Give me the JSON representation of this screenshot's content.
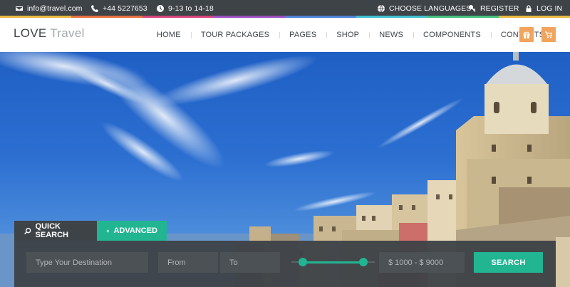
{
  "topbar": {
    "email": "info@travel.com",
    "phone": "+44 5227653",
    "hours": "9-13 to 14-18",
    "languages": "CHOOSE LANGUAGES",
    "register": "REGISTER",
    "login": "LOG IN"
  },
  "brand": {
    "bold": "LOVE",
    "light": "Travel"
  },
  "nav": {
    "items": [
      "HOME",
      "TOUR PACKAGES",
      "PAGES",
      "SHOP",
      "NEWS",
      "COMPONENTS",
      "CONTACTS"
    ]
  },
  "search": {
    "tabs": {
      "quick": "QUICK SEARCH",
      "advanced": "ADVANCED"
    },
    "destination_placeholder": "Type Your Destination",
    "from_placeholder": "From",
    "to_placeholder": "To",
    "price_range": "$ 1000 - $ 9000",
    "button": "SEARCH"
  },
  "colors": {
    "dark": "#3e4348",
    "accent": "#22b592",
    "nav_button": "#f0a45d",
    "rainbow": [
      "#e8b93f",
      "#e8703f",
      "#d9437c",
      "#9a4fc2",
      "#4f7fd6",
      "#3fbfd0",
      "#46c07a",
      "#e8b93f"
    ]
  },
  "icons": {
    "email": "envelope-icon",
    "phone": "phone-icon",
    "hours": "clock-icon",
    "languages": "globe-icon",
    "register": "key-icon",
    "login": "lock-icon",
    "gift": "gift-icon",
    "cart": "cart-icon",
    "quick_search": "search-icon",
    "advanced": "sliders-icon"
  }
}
